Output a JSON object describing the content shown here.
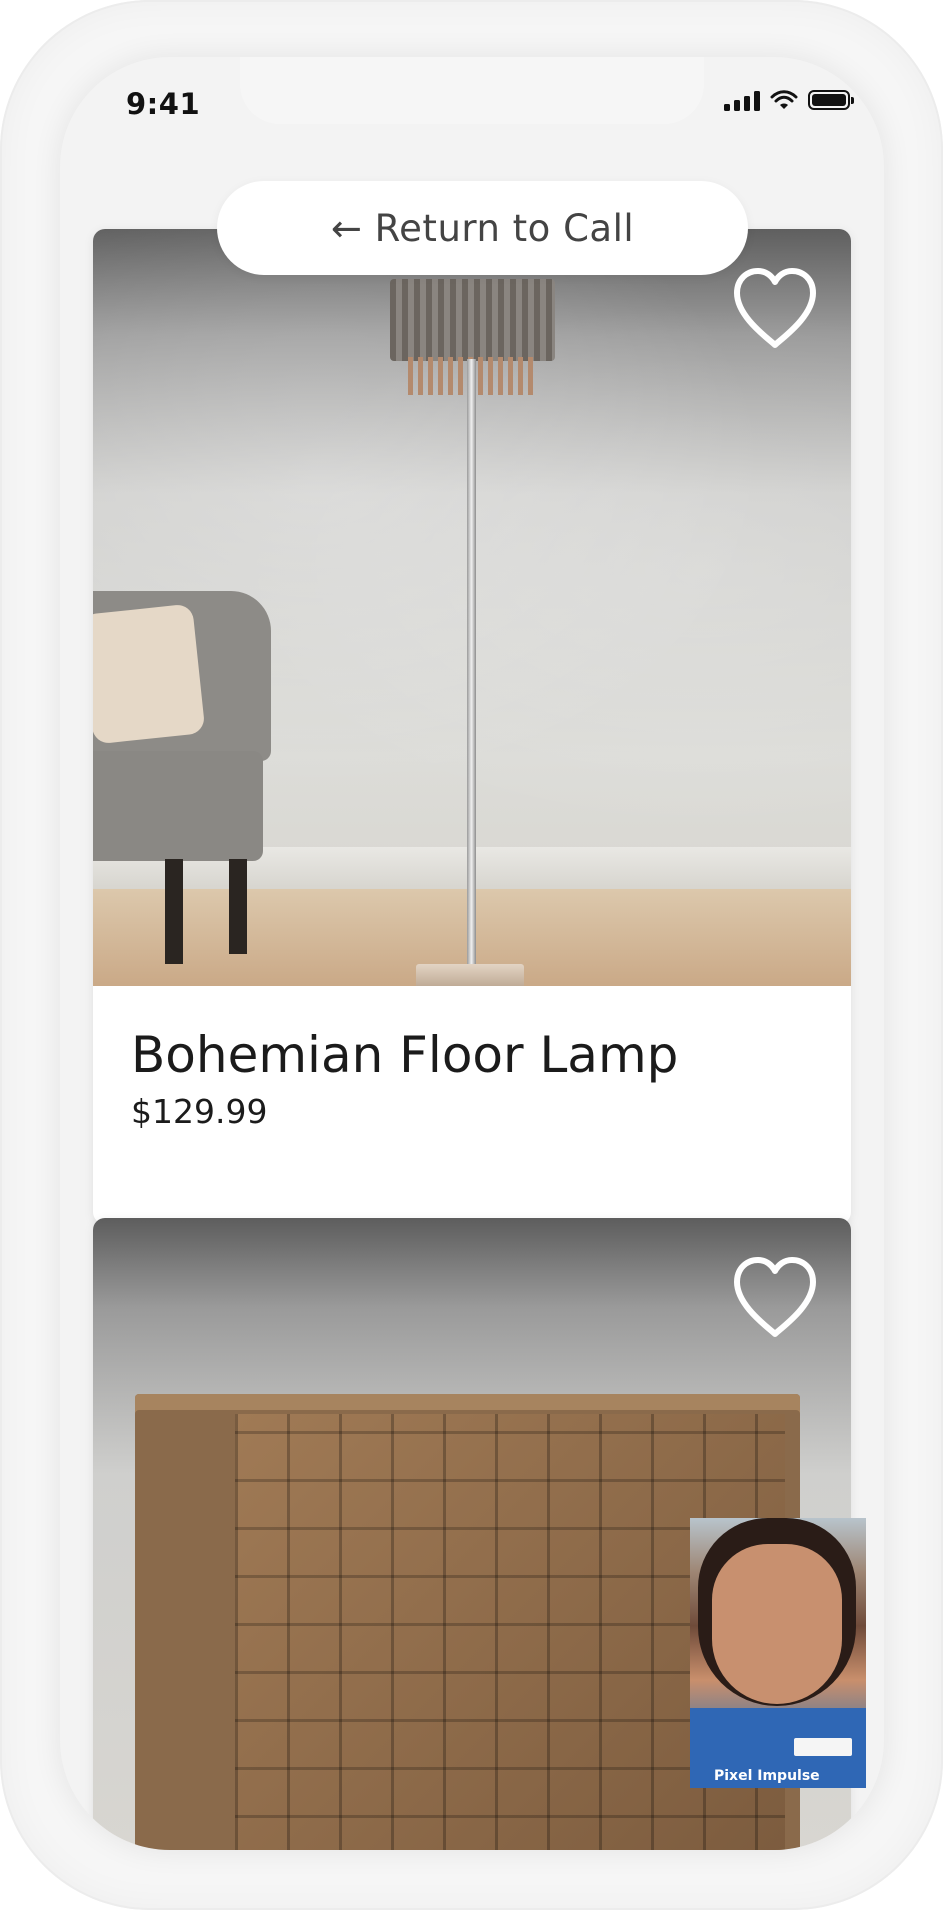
{
  "status_bar": {
    "time": "9:41",
    "icons": [
      "signal-icon",
      "wifi-icon",
      "battery-icon"
    ]
  },
  "return_button": {
    "label": "← Return to Call"
  },
  "products": [
    {
      "title": "Bohemian Floor Lamp",
      "price": "$129.99",
      "favorite_icon": "heart-outline-icon"
    },
    {
      "title": "",
      "price": "",
      "favorite_icon": "heart-outline-icon"
    }
  ],
  "video_pip": {
    "badge_text": "Pixel Impulse"
  }
}
